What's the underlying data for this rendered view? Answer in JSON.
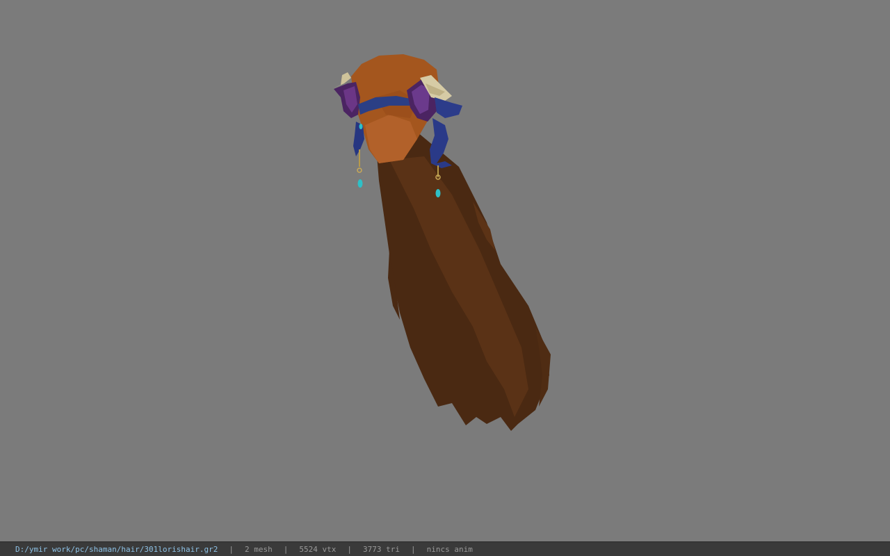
{
  "viewport": {
    "background": "#7b7b7b",
    "model": "hair-mesh-with-horn-headpiece"
  },
  "statusbar": {
    "file_path": "D:/ymir work/pc/shaman/hair/301lorishair.gr2",
    "separator": "|",
    "mesh_count": "2 mesh",
    "vertex_count": "5524 vtx",
    "triangle_count": "3773 tri",
    "anim_status": "nincs anim",
    "path_color": "#8ec2e6",
    "text_color": "#9a9a9a"
  }
}
